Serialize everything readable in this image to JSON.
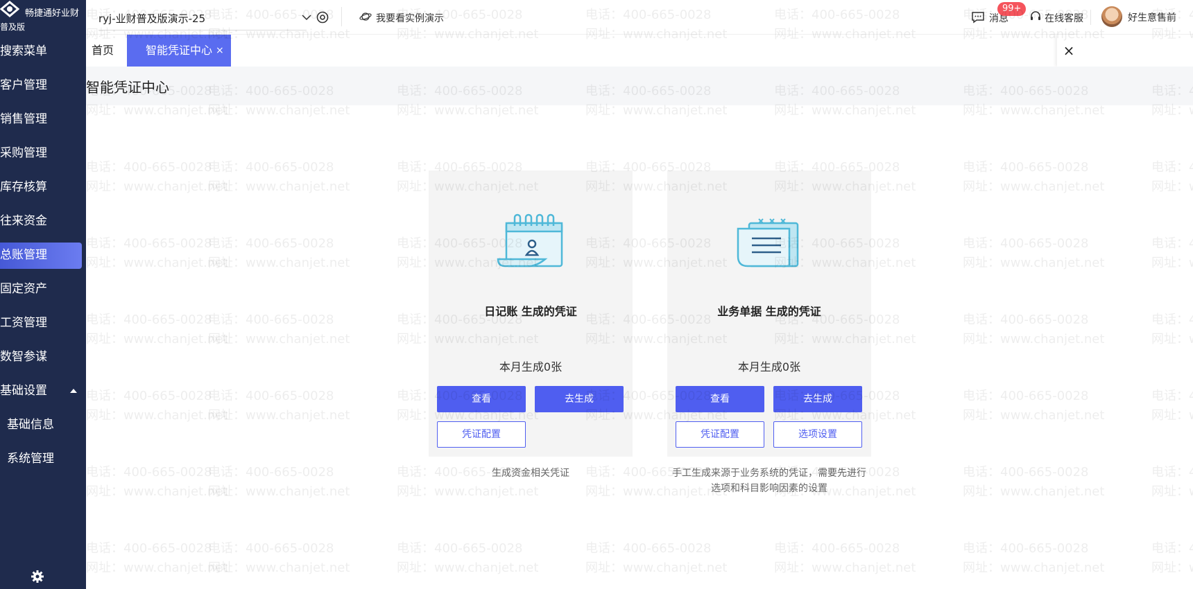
{
  "app": {
    "brand": "畅捷通好业财",
    "edition": "普及版"
  },
  "sidebar": {
    "items": [
      {
        "label": "搜索菜单"
      },
      {
        "label": "客户管理"
      },
      {
        "label": "销售管理"
      },
      {
        "label": "采购管理"
      },
      {
        "label": "库存核算"
      },
      {
        "label": "往来资金"
      },
      {
        "label": "总账管理",
        "active": true
      },
      {
        "label": "固定资产"
      },
      {
        "label": "工资管理"
      },
      {
        "label": "数智参谋"
      },
      {
        "label": "基础设置",
        "expanded": true
      },
      {
        "label": "基础信息",
        "sub": true
      },
      {
        "label": "系统管理",
        "sub": true
      }
    ],
    "settings_icon": "gear-icon"
  },
  "header": {
    "account": "ryj-业财普及版演示-25",
    "demo_link": "我要看实例演示",
    "messages_label": "消息",
    "messages_badge": "99+",
    "service_label": "在线客服",
    "username": "好生意售前"
  },
  "tabs": {
    "home": "首页",
    "active": "智能凭证中心",
    "active_close": "×",
    "close_all": "×"
  },
  "page": {
    "title": "智能凭证中心"
  },
  "cards": [
    {
      "title": "日记账 生成的凭证",
      "count": "本月生成0张",
      "buttons": [
        "查看",
        "去生成",
        "凭证配置"
      ],
      "desc_line1": "生成资金相关凭证",
      "desc_line2": ""
    },
    {
      "title": "业务单据 生成的凭证",
      "count": "本月生成0张",
      "buttons": [
        "查看",
        "去生成",
        "凭证配置",
        "选项设置"
      ],
      "desc_line1": "手工生成来源于业务系统的凭证，需要先进行",
      "desc_line2": "选项和科目影响因素的设置"
    }
  ],
  "watermark": {
    "phone": "电话：400-665-0028",
    "site": "网址：www.chanjet.net"
  },
  "colors": {
    "sidebar_bg": "#1f2b4d",
    "primary": "#4f5ef0",
    "tab_active": "#5a6cf0",
    "badge": "#f5545c"
  }
}
